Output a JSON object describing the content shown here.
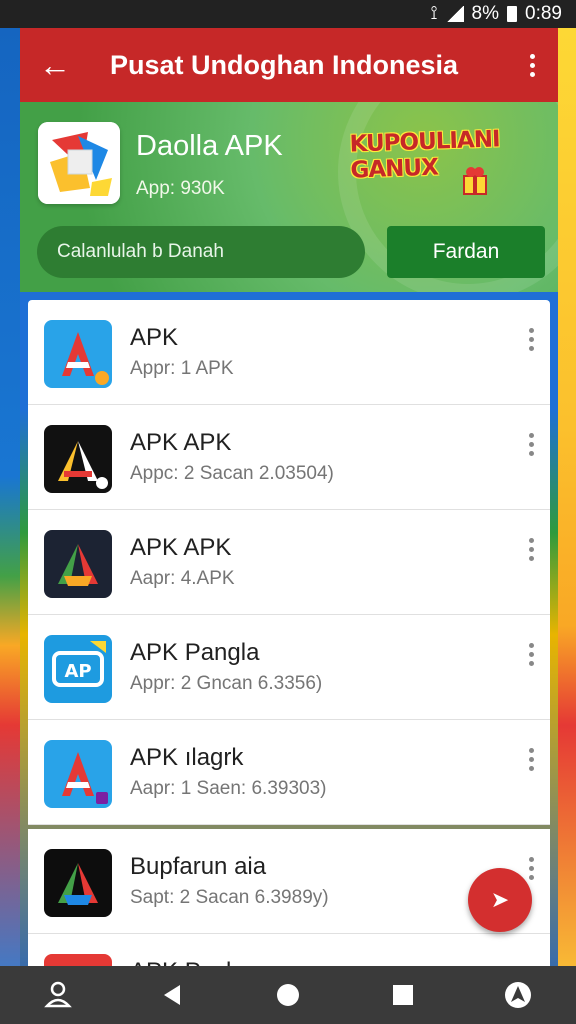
{
  "status": {
    "icons": [
      "vibrate-icon",
      "signal-icon"
    ],
    "battery_text": "8%",
    "time": "0:89"
  },
  "app_bar": {
    "title": "Pusat Undoghan Indonesia"
  },
  "banner": {
    "app_name": "Daolla APK",
    "app_sub": "App: 930K",
    "promo": "KUPOULIANI GANUX",
    "search_placeholder": "Calanlulah b Danah",
    "search_button": "Fardan"
  },
  "items": [
    {
      "name": "APK",
      "meta": "Appr: 1 APK",
      "icon": "android-red-icon"
    },
    {
      "name": "APK APK",
      "meta": "Appc: 2 Sacan 2.03504)",
      "icon": "android-dark-icon"
    },
    {
      "name": "APK APK",
      "meta": "Aapr: 4.APK",
      "icon": "android-dark-icon"
    },
    {
      "name": "APK Pangla",
      "meta": "Appr: 2 Gncan 6.3356)",
      "icon": "apk-blue-icon"
    },
    {
      "name": "APK ılagrk",
      "meta": "Aapr: 1 Saen: 6.39303)",
      "icon": "android-red-icon"
    },
    {
      "name": "Bupfarun aia",
      "meta": "Sapt: 2 Sacan 6.3989y)",
      "icon": "android-dark-icon"
    },
    {
      "name": "APK Pack",
      "meta": "",
      "icon": "android-red-icon"
    }
  ],
  "colors": {
    "primary": "#c62828",
    "accent_green": "#43a047",
    "fab": "#d32f2f"
  }
}
